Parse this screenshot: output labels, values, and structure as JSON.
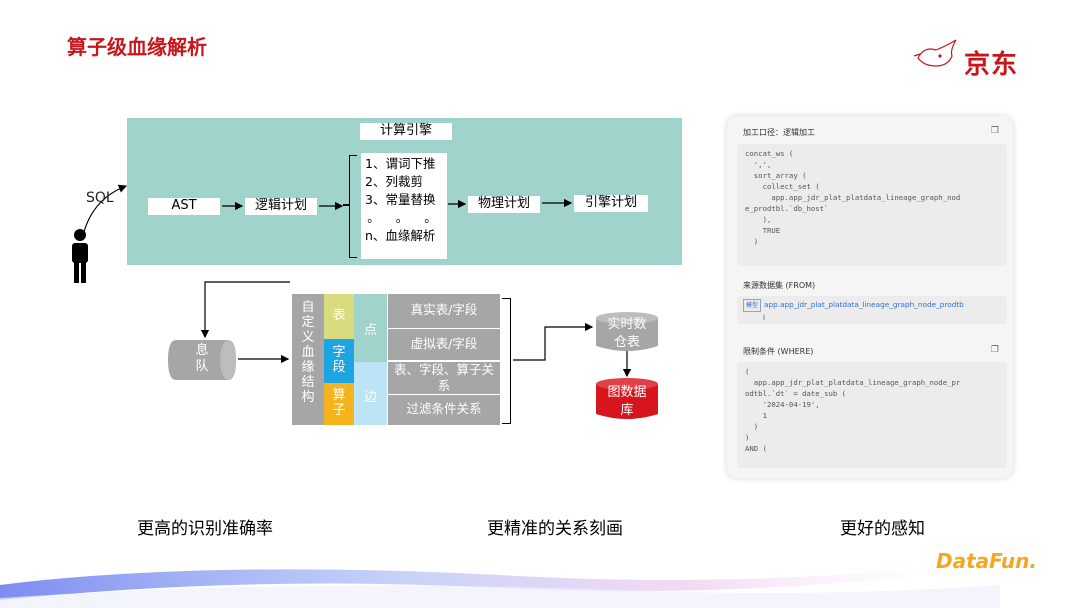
{
  "title": "算子级血缘解析",
  "logo": {
    "text": "京东"
  },
  "diagram": {
    "sql_label": "SQL",
    "ast": "AST",
    "logical_plan": "逻辑计划",
    "engine_title": "计算引擎",
    "engine_items": [
      "1、谓词下推",
      "2、列裁剪",
      "3、常量替换",
      "。 。 。",
      "n、血缘解析"
    ],
    "physical_plan": "物理计划",
    "engine_plan": "引擎计划",
    "queue": [
      "息",
      "队"
    ],
    "struct_label": [
      "自",
      "定",
      "义",
      "血",
      "缘",
      "结",
      "构"
    ],
    "seg_table": "表",
    "seg_field": [
      "字",
      "段"
    ],
    "seg_operator": [
      "算",
      "子"
    ],
    "node_label": "点",
    "edge_label": "边",
    "cells": [
      "真实表/字段",
      "虚拟表/字段",
      "表、字段、算子关系",
      "过滤条件关系"
    ],
    "realtime_store": [
      "实时数",
      "仓表"
    ],
    "graph_db": [
      "图数据",
      "库"
    ]
  },
  "screenshot": {
    "section1_title": "加工口径：逻辑加工",
    "code1": "concat_ws (\n  ',',\n  sort_array (\n    collect_set (\n      app.app_jdr_plat_platdata_lineage_graph_nod\ne_prodtbl.`db_host`\n    ),\n    TRUE\n  )",
    "section2_title": "来源数据集 (FROM)",
    "from_tag": "模型",
    "from_text": "app.app_jdr_plat_platdata_lineage_graph_node_prodtb",
    "from_text2": "l",
    "section3_title": "限制条件 (WHERE)",
    "code3": "(\n  app.app_jdr_plat_platdata_lineage_graph_node_pr\nodtbl.`dt` = date_sub (\n    '2024-04-19',\n    1\n  )\n)\nAND (",
    "copy_icon": "copy-icon"
  },
  "captions": [
    "更高的识别准确率",
    "更精准的关系刻画",
    "更好的感知"
  ],
  "footer_logo": "DataFun.",
  "colors": {
    "title_red": "#c8161d",
    "teal": "#9fd3cb",
    "gray": "#a6a6a6",
    "yellow_green": "#d8dc7e",
    "blue": "#1ba5e3",
    "orange": "#f5b31d",
    "light_blue": "#bde3f7",
    "db_red": "#d7151d"
  }
}
